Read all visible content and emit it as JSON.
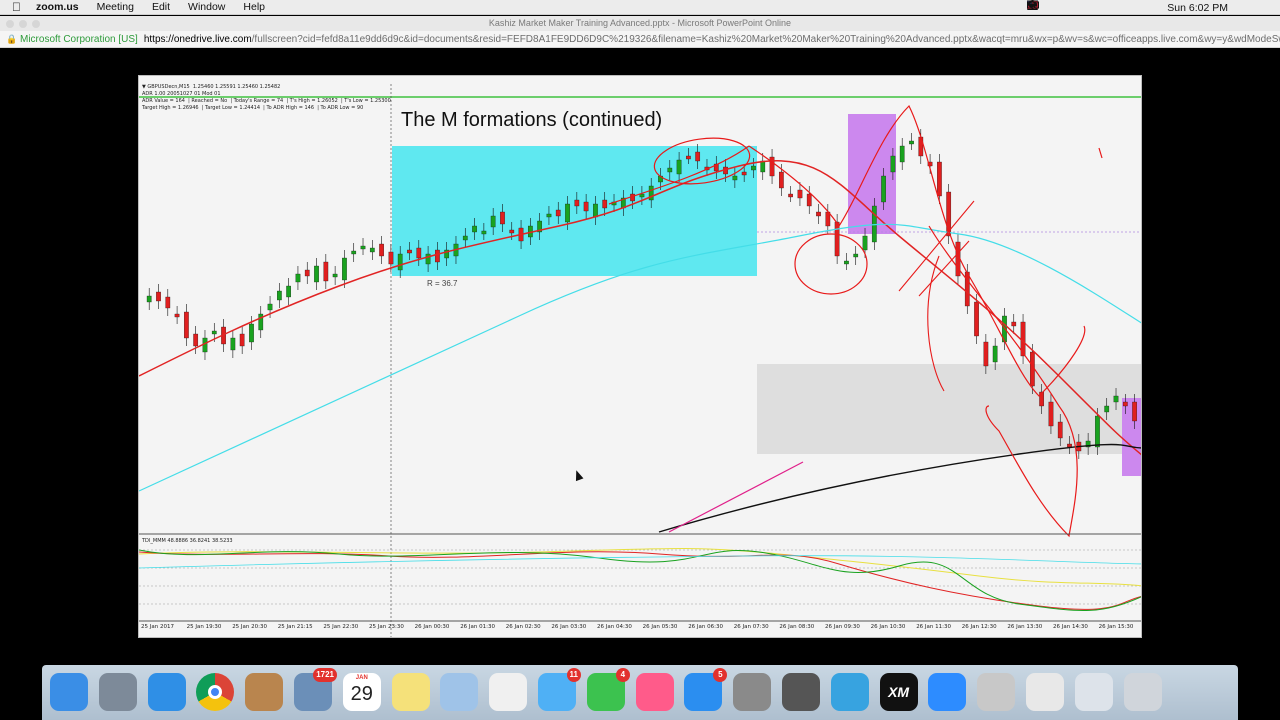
{
  "menubar": {
    "app_name": "zoom.us",
    "menus": [
      "Meeting",
      "Edit",
      "Window",
      "Help"
    ],
    "clock": "Sun 6:02 PM"
  },
  "window": {
    "title": "Kashiz Market Maker Training Advanced.pptx - Microsoft PowerPoint Online"
  },
  "address": {
    "org": "Microsoft Corporation [US]",
    "host": "https://onedrive.live.com",
    "path": "/fullscreen?cid=fefd8a11e9dd6d9c&id=documents&resid=FEFD8A1FE9DD6D9C%219326&filename=Kashiz%20Market%20Maker%20Training%20Advanced.pptx&wacqt=mru&wx=p&wv=s&wc=officeapps.live.com&wy=y&wdModeSwitc..."
  },
  "slide": {
    "title": "The M formations (continued)",
    "chart_info_lines": [
      "▼ GBPUSDecn,M15  1.25460 1.25591 1.25460 1.25482",
      "ADR 1.00 20051027 01 Mod 01",
      "ADR Value = 164  | Reached = No  | Today's Range = 74  | T's High = 1.26052  | T's Low = 1.25300",
      "Target High = 1.26946  | Target Low = 1.24414  | To ADR High = 146  | To ADR Low = 90"
    ],
    "indicator_label": "TDI_MMM 48.8886 36.8241 38.5233",
    "r_label": "R = 36.7",
    "time_labels": [
      "25 Jan 2017",
      "25 Jan 19:30",
      "25 Jan 20:30",
      "25 Jan 21:15",
      "25 Jan 22:30",
      "25 Jan 23:30",
      "26 Jan 00:30",
      "26 Jan 01:30",
      "26 Jan 02:30",
      "26 Jan 03:30",
      "26 Jan 04:30",
      "26 Jan 05:30",
      "26 Jan 06:30",
      "26 Jan 07:30",
      "26 Jan 08:30",
      "26 Jan 09:30",
      "26 Jan 10:30",
      "26 Jan 11:30",
      "26 Jan 12:30",
      "26 Jan 13:30",
      "26 Jan 14:30",
      "26 Jan 15:30"
    ]
  },
  "dock": {
    "apps": [
      {
        "name": "Finder",
        "color": "#3a8ee6"
      },
      {
        "name": "Launchpad",
        "color": "#7d8a99"
      },
      {
        "name": "Safari",
        "color": "#2f8fe6"
      },
      {
        "name": "Chrome",
        "color": "#ffffff"
      },
      {
        "name": "Contacts",
        "color": "#b9854e"
      },
      {
        "name": "Mail Stamp",
        "color": "#6b8fb8",
        "badge": "1721"
      },
      {
        "name": "Calendar",
        "color": "#ffffff",
        "month": "JAN",
        "day": "29"
      },
      {
        "name": "Notes",
        "color": "#f5e17a"
      },
      {
        "name": "Preview",
        "color": "#9fc3e8"
      },
      {
        "name": "Photos",
        "color": "#f0f0f0"
      },
      {
        "name": "Messages",
        "color": "#4fb0f5",
        "badge": "11"
      },
      {
        "name": "FaceTime",
        "color": "#3cc24f",
        "badge": "4"
      },
      {
        "name": "iTunes",
        "color": "#ff5b8a"
      },
      {
        "name": "App Store",
        "color": "#2b8ef0",
        "badge": "5"
      },
      {
        "name": "System Preferences",
        "color": "#8a8a8a"
      },
      {
        "name": "Camera",
        "color": "#555555"
      },
      {
        "name": "Telegram",
        "color": "#37a3e0"
      },
      {
        "name": "XM",
        "color": "#111111",
        "label": "XM"
      },
      {
        "name": "Zoom",
        "color": "#2d8cff"
      },
      {
        "name": "Pencil",
        "color": "#c8c8c8"
      },
      {
        "name": "Documents",
        "color": "#e8e8e8"
      },
      {
        "name": "Downloads",
        "color": "#dde3ea"
      },
      {
        "name": "Trash",
        "color": "#d0d5db"
      }
    ]
  }
}
